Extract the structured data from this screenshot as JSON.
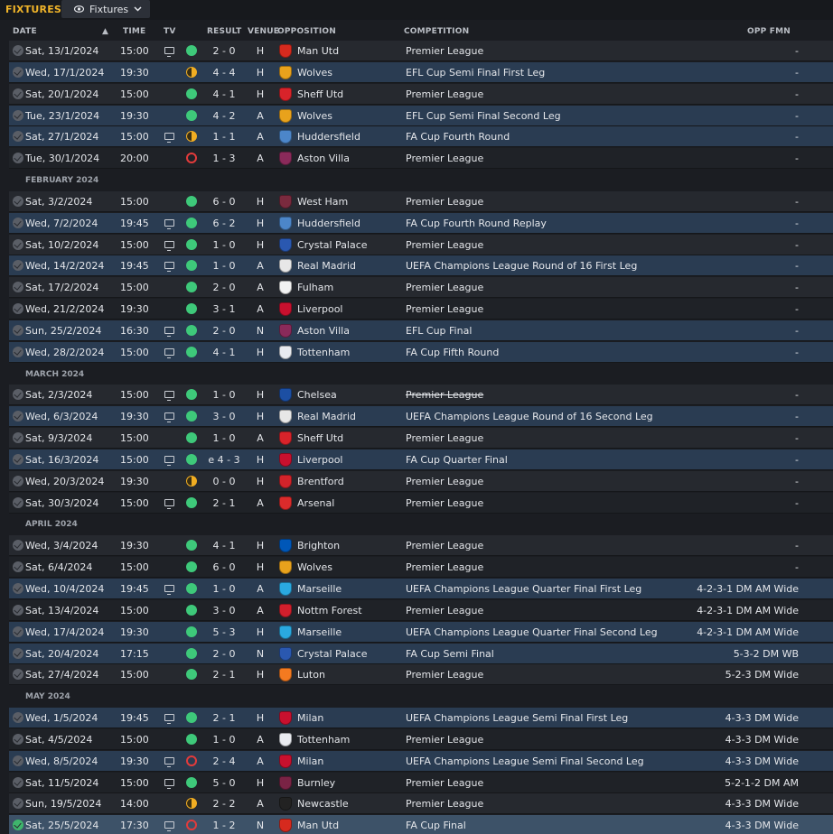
{
  "header": {
    "title": "FIXTURES",
    "view_label": "Fixtures"
  },
  "columns": {
    "date": "DATE",
    "time": "TIME",
    "tv": "TV",
    "result": "RESULT",
    "venue": "VENUE",
    "opposition": "OPPOSITION",
    "competition": "COMPETITION",
    "opp_fmn": "OPP FMN"
  },
  "colors": {
    "accent": "#f0b429",
    "win": "#3ec97a",
    "draw": "#f1ad22",
    "loss": "#e23b3b",
    "highlight_row": "#2a3c52"
  },
  "rows": [
    {
      "type": "fixture",
      "date": "Sat, 13/1/2024",
      "time": "15:00",
      "tv": true,
      "outcome": "W",
      "result": "2 - 0",
      "venue": "H",
      "opposition": "Man Utd",
      "crest": "#d62a1e",
      "competition": "Premier League",
      "fmn": "-",
      "hl": false
    },
    {
      "type": "fixture",
      "date": "Wed, 17/1/2024",
      "time": "19:30",
      "tv": false,
      "outcome": "D",
      "result": "4 - 4",
      "venue": "H",
      "opposition": "Wolves",
      "crest": "#e8a21c",
      "competition": "EFL Cup Semi Final First Leg",
      "fmn": "-",
      "hl": true
    },
    {
      "type": "fixture",
      "date": "Sat, 20/1/2024",
      "time": "15:00",
      "tv": false,
      "outcome": "W",
      "result": "4 - 1",
      "venue": "H",
      "opposition": "Sheff Utd",
      "crest": "#d8232a",
      "competition": "Premier League",
      "fmn": "-",
      "hl": false
    },
    {
      "type": "fixture",
      "date": "Tue, 23/1/2024",
      "time": "19:30",
      "tv": false,
      "outcome": "W",
      "result": "4 - 2",
      "venue": "A",
      "opposition": "Wolves",
      "crest": "#e8a21c",
      "competition": "EFL Cup Semi Final Second Leg",
      "fmn": "-",
      "hl": true
    },
    {
      "type": "fixture",
      "date": "Sat, 27/1/2024",
      "time": "15:00",
      "tv": true,
      "outcome": "D",
      "result": "1 - 1",
      "venue": "A",
      "opposition": "Huddersfield",
      "crest": "#4c86c9",
      "competition": "FA Cup Fourth Round",
      "fmn": "-",
      "hl": true
    },
    {
      "type": "fixture",
      "date": "Tue, 30/1/2024",
      "time": "20:00",
      "tv": false,
      "outcome": "L",
      "result": "1 - 3",
      "venue": "A",
      "opposition": "Aston Villa",
      "crest": "#8a2a5a",
      "competition": "Premier League",
      "fmn": "-",
      "hl": false
    },
    {
      "type": "month",
      "label": "FEBRUARY 2024"
    },
    {
      "type": "fixture",
      "date": "Sat, 3/2/2024",
      "time": "15:00",
      "tv": false,
      "outcome": "W",
      "result": "6 - 0",
      "venue": "H",
      "opposition": "West Ham",
      "crest": "#7a2a3e",
      "competition": "Premier League",
      "fmn": "-",
      "hl": false
    },
    {
      "type": "fixture",
      "date": "Wed, 7/2/2024",
      "time": "19:45",
      "tv": true,
      "outcome": "W",
      "result": "6 - 2",
      "venue": "H",
      "opposition": "Huddersfield",
      "crest": "#4c86c9",
      "competition": "FA Cup Fourth Round Replay",
      "fmn": "-",
      "hl": true
    },
    {
      "type": "fixture",
      "date": "Sat, 10/2/2024",
      "time": "15:00",
      "tv": true,
      "outcome": "W",
      "result": "1 - 0",
      "venue": "H",
      "opposition": "Crystal Palace",
      "crest": "#2a58b0",
      "competition": "Premier League",
      "fmn": "-",
      "hl": false
    },
    {
      "type": "fixture",
      "date": "Wed, 14/2/2024",
      "time": "19:45",
      "tv": true,
      "outcome": "W",
      "result": "1 - 0",
      "venue": "A",
      "opposition": "Real Madrid",
      "crest": "#e7e7e7",
      "competition": "UEFA Champions League Round of 16 First Leg",
      "fmn": "-",
      "hl": true
    },
    {
      "type": "fixture",
      "date": "Sat, 17/2/2024",
      "time": "15:00",
      "tv": false,
      "outcome": "W",
      "result": "2 - 0",
      "venue": "A",
      "opposition": "Fulham",
      "crest": "#f2f2f2",
      "competition": "Premier League",
      "fmn": "-",
      "hl": false
    },
    {
      "type": "fixture",
      "date": "Wed, 21/2/2024",
      "time": "19:30",
      "tv": false,
      "outcome": "W",
      "result": "3 - 1",
      "venue": "A",
      "opposition": "Liverpool",
      "crest": "#c8102e",
      "competition": "Premier League",
      "fmn": "-",
      "hl": false
    },
    {
      "type": "fixture",
      "date": "Sun, 25/2/2024",
      "time": "16:30",
      "tv": true,
      "outcome": "W",
      "result": "2 - 0",
      "venue": "N",
      "opposition": "Aston Villa",
      "crest": "#8a2a5a",
      "competition": "EFL Cup Final",
      "fmn": "-",
      "hl": true
    },
    {
      "type": "fixture",
      "date": "Wed, 28/2/2024",
      "time": "15:00",
      "tv": true,
      "outcome": "W",
      "result": "4 - 1",
      "venue": "H",
      "opposition": "Tottenham",
      "crest": "#e9ebf0",
      "competition": "FA Cup Fifth Round",
      "fmn": "-",
      "hl": true
    },
    {
      "type": "month",
      "label": "MARCH 2024"
    },
    {
      "type": "fixture",
      "date": "Sat, 2/3/2024",
      "time": "15:00",
      "tv": true,
      "outcome": "W",
      "result": "1 - 0",
      "venue": "H",
      "opposition": "Chelsea",
      "crest": "#1c4fa3",
      "competition": "Premier League",
      "fmn": "-",
      "hl": false,
      "strike": true
    },
    {
      "type": "fixture",
      "date": "Wed, 6/3/2024",
      "time": "19:30",
      "tv": true,
      "outcome": "W",
      "result": "3 - 0",
      "venue": "H",
      "opposition": "Real Madrid",
      "crest": "#e7e7e7",
      "competition": "UEFA Champions League Round of 16 Second Leg",
      "fmn": "-",
      "hl": true
    },
    {
      "type": "fixture",
      "date": "Sat, 9/3/2024",
      "time": "15:00",
      "tv": false,
      "outcome": "W",
      "result": "1 - 0",
      "venue": "A",
      "opposition": "Sheff Utd",
      "crest": "#d8232a",
      "competition": "Premier League",
      "fmn": "-",
      "hl": false
    },
    {
      "type": "fixture",
      "date": "Sat, 16/3/2024",
      "time": "15:00",
      "tv": true,
      "outcome": "W",
      "result": "e 4 - 3",
      "venue": "H",
      "opposition": "Liverpool",
      "crest": "#c8102e",
      "competition": "FA Cup Quarter Final",
      "fmn": "-",
      "hl": true
    },
    {
      "type": "fixture",
      "date": "Wed, 20/3/2024",
      "time": "19:30",
      "tv": false,
      "outcome": "D",
      "result": "0 - 0",
      "venue": "H",
      "opposition": "Brentford",
      "crest": "#d2232a",
      "competition": "Premier League",
      "fmn": "-",
      "hl": false
    },
    {
      "type": "fixture",
      "date": "Sat, 30/3/2024",
      "time": "15:00",
      "tv": true,
      "outcome": "W",
      "result": "2 - 1",
      "venue": "A",
      "opposition": "Arsenal",
      "crest": "#db2b2b",
      "competition": "Premier League",
      "fmn": "-",
      "hl": false
    },
    {
      "type": "month",
      "label": "APRIL 2024"
    },
    {
      "type": "fixture",
      "date": "Wed, 3/4/2024",
      "time": "19:30",
      "tv": false,
      "outcome": "W",
      "result": "4 - 1",
      "venue": "H",
      "opposition": "Brighton",
      "crest": "#0057b8",
      "competition": "Premier League",
      "fmn": "-",
      "hl": false
    },
    {
      "type": "fixture",
      "date": "Sat, 6/4/2024",
      "time": "15:00",
      "tv": false,
      "outcome": "W",
      "result": "6 - 0",
      "venue": "H",
      "opposition": "Wolves",
      "crest": "#e8a21c",
      "competition": "Premier League",
      "fmn": "-",
      "hl": false
    },
    {
      "type": "fixture",
      "date": "Wed, 10/4/2024",
      "time": "19:45",
      "tv": true,
      "outcome": "W",
      "result": "1 - 0",
      "venue": "A",
      "opposition": "Marseille",
      "crest": "#2aa9e0",
      "competition": "UEFA Champions League Quarter Final First Leg",
      "fmn": "4-2-3-1 DM AM Wide",
      "hl": true
    },
    {
      "type": "fixture",
      "date": "Sat, 13/4/2024",
      "time": "15:00",
      "tv": false,
      "outcome": "W",
      "result": "3 - 0",
      "venue": "A",
      "opposition": "Nottm Forest",
      "crest": "#d11f2c",
      "competition": "Premier League",
      "fmn": "4-2-3-1 DM AM Wide",
      "hl": false
    },
    {
      "type": "fixture",
      "date": "Wed, 17/4/2024",
      "time": "19:30",
      "tv": false,
      "outcome": "W",
      "result": "5 - 3",
      "venue": "H",
      "opposition": "Marseille",
      "crest": "#2aa9e0",
      "competition": "UEFA Champions League Quarter Final Second Leg",
      "fmn": "4-2-3-1 DM AM Wide",
      "hl": true
    },
    {
      "type": "fixture",
      "date": "Sat, 20/4/2024",
      "time": "17:15",
      "tv": false,
      "outcome": "W",
      "result": "2 - 0",
      "venue": "N",
      "opposition": "Crystal Palace",
      "crest": "#2a58b0",
      "competition": "FA Cup Semi Final",
      "fmn": "5-3-2 DM WB",
      "hl": true
    },
    {
      "type": "fixture",
      "date": "Sat, 27/4/2024",
      "time": "15:00",
      "tv": false,
      "outcome": "W",
      "result": "2 - 1",
      "venue": "H",
      "opposition": "Luton",
      "crest": "#f47a20",
      "competition": "Premier League",
      "fmn": "5-2-3 DM Wide",
      "hl": false
    },
    {
      "type": "month",
      "label": "MAY 2024"
    },
    {
      "type": "fixture",
      "date": "Wed, 1/5/2024",
      "time": "19:45",
      "tv": true,
      "outcome": "W",
      "result": "2 - 1",
      "venue": "H",
      "opposition": "Milan",
      "crest": "#c8102e",
      "competition": "UEFA Champions League Semi Final First Leg",
      "fmn": "4-3-3 DM Wide",
      "hl": true
    },
    {
      "type": "fixture",
      "date": "Sat, 4/5/2024",
      "time": "15:00",
      "tv": false,
      "outcome": "W",
      "result": "1 - 0",
      "venue": "A",
      "opposition": "Tottenham",
      "crest": "#e9ebf0",
      "competition": "Premier League",
      "fmn": "4-3-3 DM Wide",
      "hl": false
    },
    {
      "type": "fixture",
      "date": "Wed, 8/5/2024",
      "time": "19:30",
      "tv": true,
      "outcome": "L",
      "result": "2 - 4",
      "venue": "A",
      "opposition": "Milan",
      "crest": "#c8102e",
      "competition": "UEFA Champions League Semi Final Second Leg",
      "fmn": "4-3-3 DM Wide",
      "hl": true
    },
    {
      "type": "fixture",
      "date": "Sat, 11/5/2024",
      "time": "15:00",
      "tv": true,
      "outcome": "W",
      "result": "5 - 0",
      "venue": "H",
      "opposition": "Burnley",
      "crest": "#7a2345",
      "competition": "Premier League",
      "fmn": "5-2-1-2 DM AM",
      "hl": false
    },
    {
      "type": "fixture",
      "date": "Sun, 19/5/2024",
      "time": "14:00",
      "tv": false,
      "outcome": "D",
      "result": "2 - 2",
      "venue": "A",
      "opposition": "Newcastle",
      "crest": "#222222",
      "competition": "Premier League",
      "fmn": "4-3-3 DM Wide",
      "hl": false
    },
    {
      "type": "fixture",
      "date": "Sat, 25/5/2024",
      "time": "17:30",
      "tv": true,
      "outcome": "L",
      "result": "1 - 2",
      "venue": "N",
      "opposition": "Man Utd",
      "crest": "#d62a1e",
      "competition": "FA Cup Final",
      "fmn": "4-3-3 DM Wide",
      "hl": false,
      "last": true
    }
  ]
}
